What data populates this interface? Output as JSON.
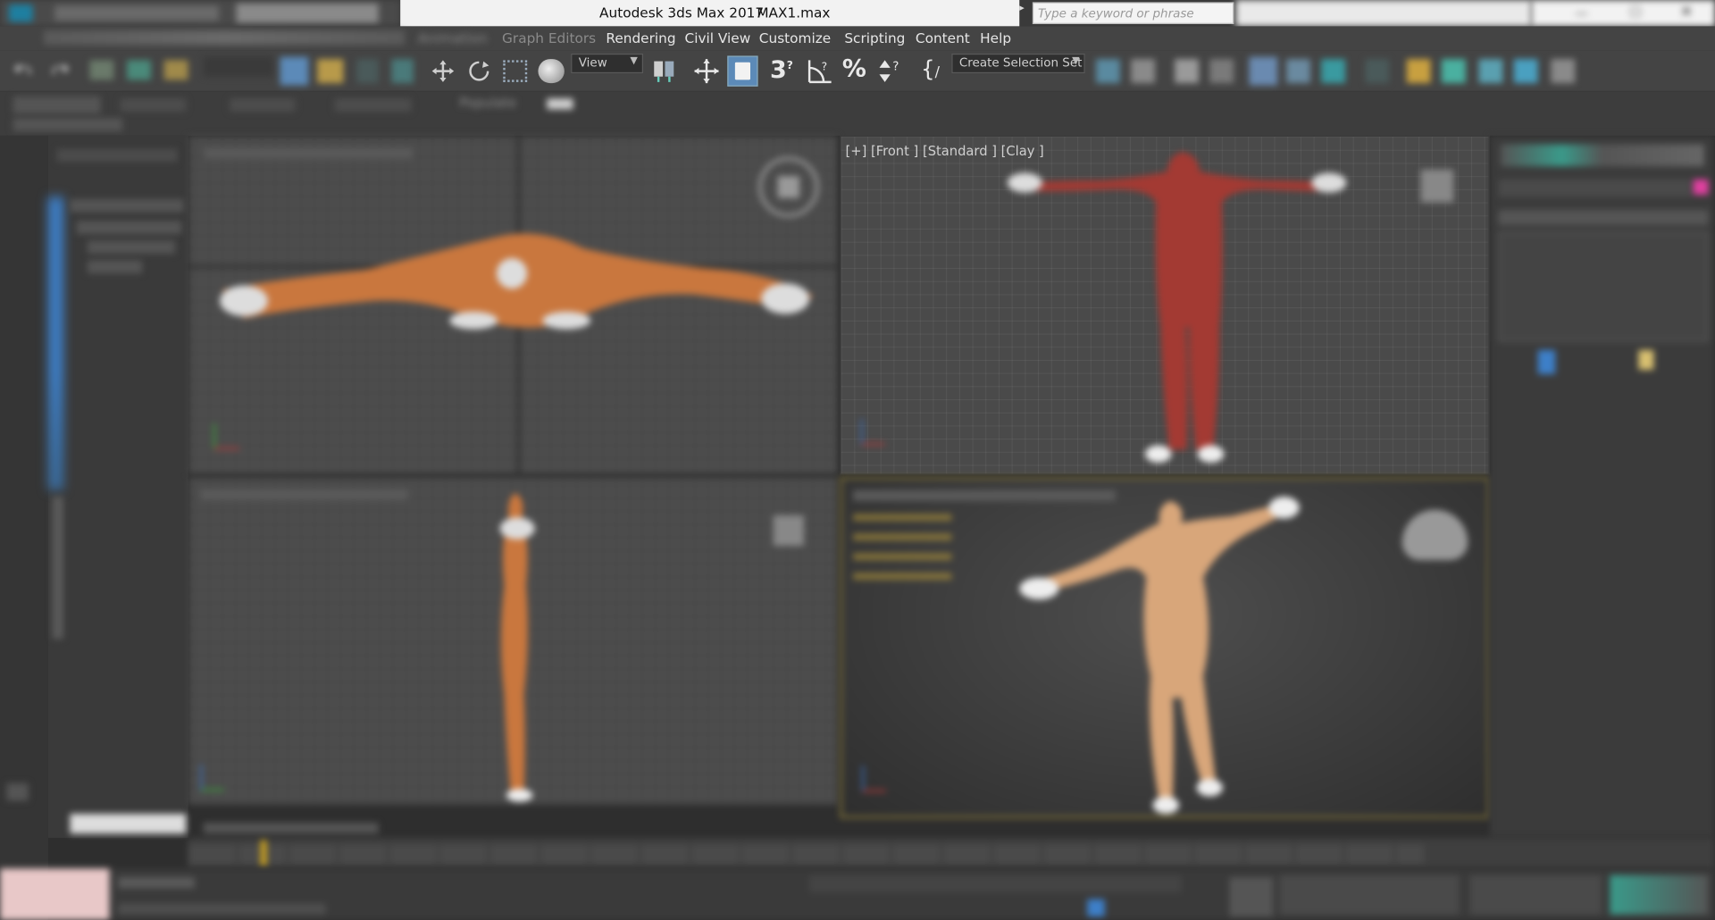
{
  "titlebar": {
    "app_title": "Autodesk 3ds Max 2017",
    "file_name": "MAX1.max",
    "search_placeholder": "Type a keyword or phrase"
  },
  "menu": {
    "items": [
      "Animation",
      "Graph Editors",
      "Rendering",
      "Civil View",
      "Customize",
      "Scripting",
      "Content",
      "Help"
    ]
  },
  "toolbar": {
    "reference_coord": "View",
    "selection_set": "Create Selection Set"
  },
  "ribbon": {
    "populate_tab": "Populate"
  },
  "viewports": {
    "front_label": "[+] [Front ] [Standard ] [Clay ]"
  },
  "colors": {
    "accent_blue": "#3d7fc8",
    "figure_orange": "#c9773e",
    "figure_red": "#a33a33",
    "figure_skin": "#d8a67a",
    "active_border": "#8a7a3a"
  },
  "icons": [
    "undo-icon",
    "redo-icon",
    "link-icon",
    "unlink-icon",
    "bind-space-warp-icon",
    "select-object-icon",
    "select-by-name-icon",
    "rectangular-selection-icon",
    "window-crossing-icon",
    "select-move-icon",
    "select-rotate-icon",
    "select-scale-icon",
    "select-place-icon",
    "use-pivot-icon",
    "select-manipulate-icon",
    "keyboard-shortcut-icon",
    "snaps-toggle-icon",
    "angle-snap-icon",
    "percent-snap-icon",
    "spinner-snap-icon",
    "edit-named-selection-icon",
    "mirror-icon",
    "align-icon",
    "toggle-scene-explorer-icon",
    "toggle-layer-explorer-icon",
    "toggle-ribbon-icon",
    "curve-editor-icon",
    "schematic-view-icon",
    "material-editor-icon",
    "render-setup-icon",
    "rendered-frame-window-icon",
    "render-production-icon",
    "render-iterative-icon",
    "render-in-cloud-icon"
  ]
}
